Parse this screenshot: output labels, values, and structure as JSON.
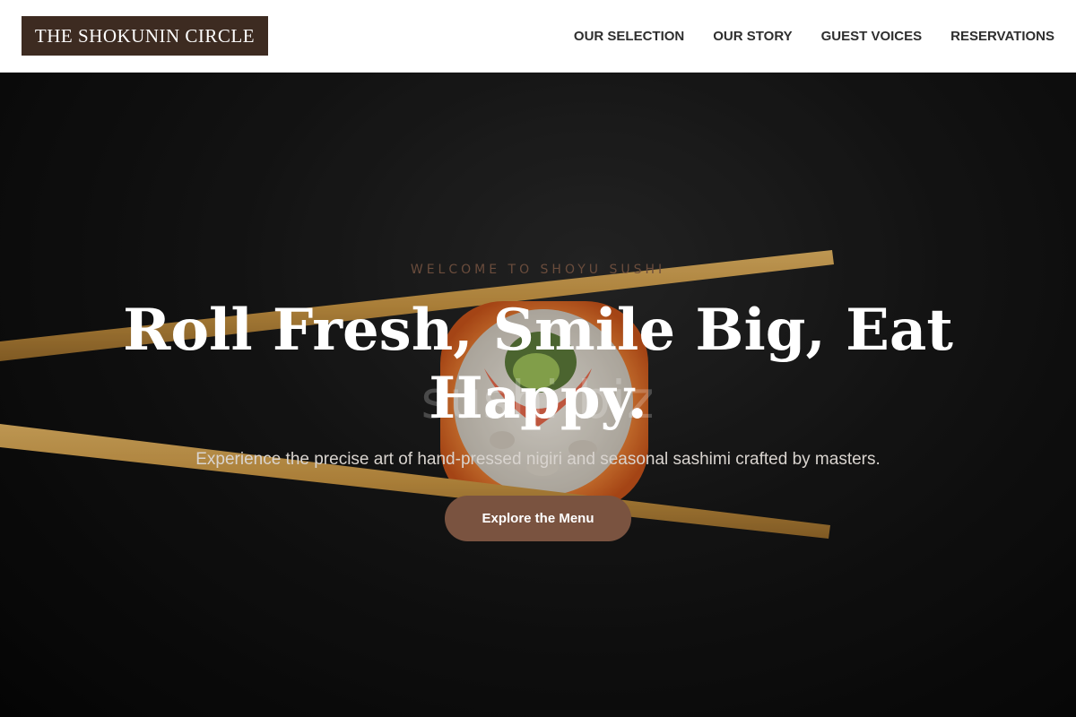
{
  "header": {
    "logo_text": "THE SHOKUNIN CIRCLE",
    "nav": [
      {
        "label": "OUR SELECTION"
      },
      {
        "label": "OUR STORY"
      },
      {
        "label": "GUEST VOICES"
      },
      {
        "label": "RESERVATIONS"
      }
    ]
  },
  "hero": {
    "eyebrow": "WELCOME TO SHOYU SUSHI",
    "headline": "Roll Fresh, Smile Big, Eat Happy.",
    "watermark": "sushi.biz",
    "subtitle": "Experience the precise art of hand-pressed nigiri and seasonal sashimi crafted by masters.",
    "cta_label": "Explore the Menu"
  },
  "colors": {
    "logo_bg": "#3d2b21",
    "cta_bg": "#7a5340",
    "eyebrow": "#6a4c3c",
    "hero_bg": "#0c0c0c"
  }
}
